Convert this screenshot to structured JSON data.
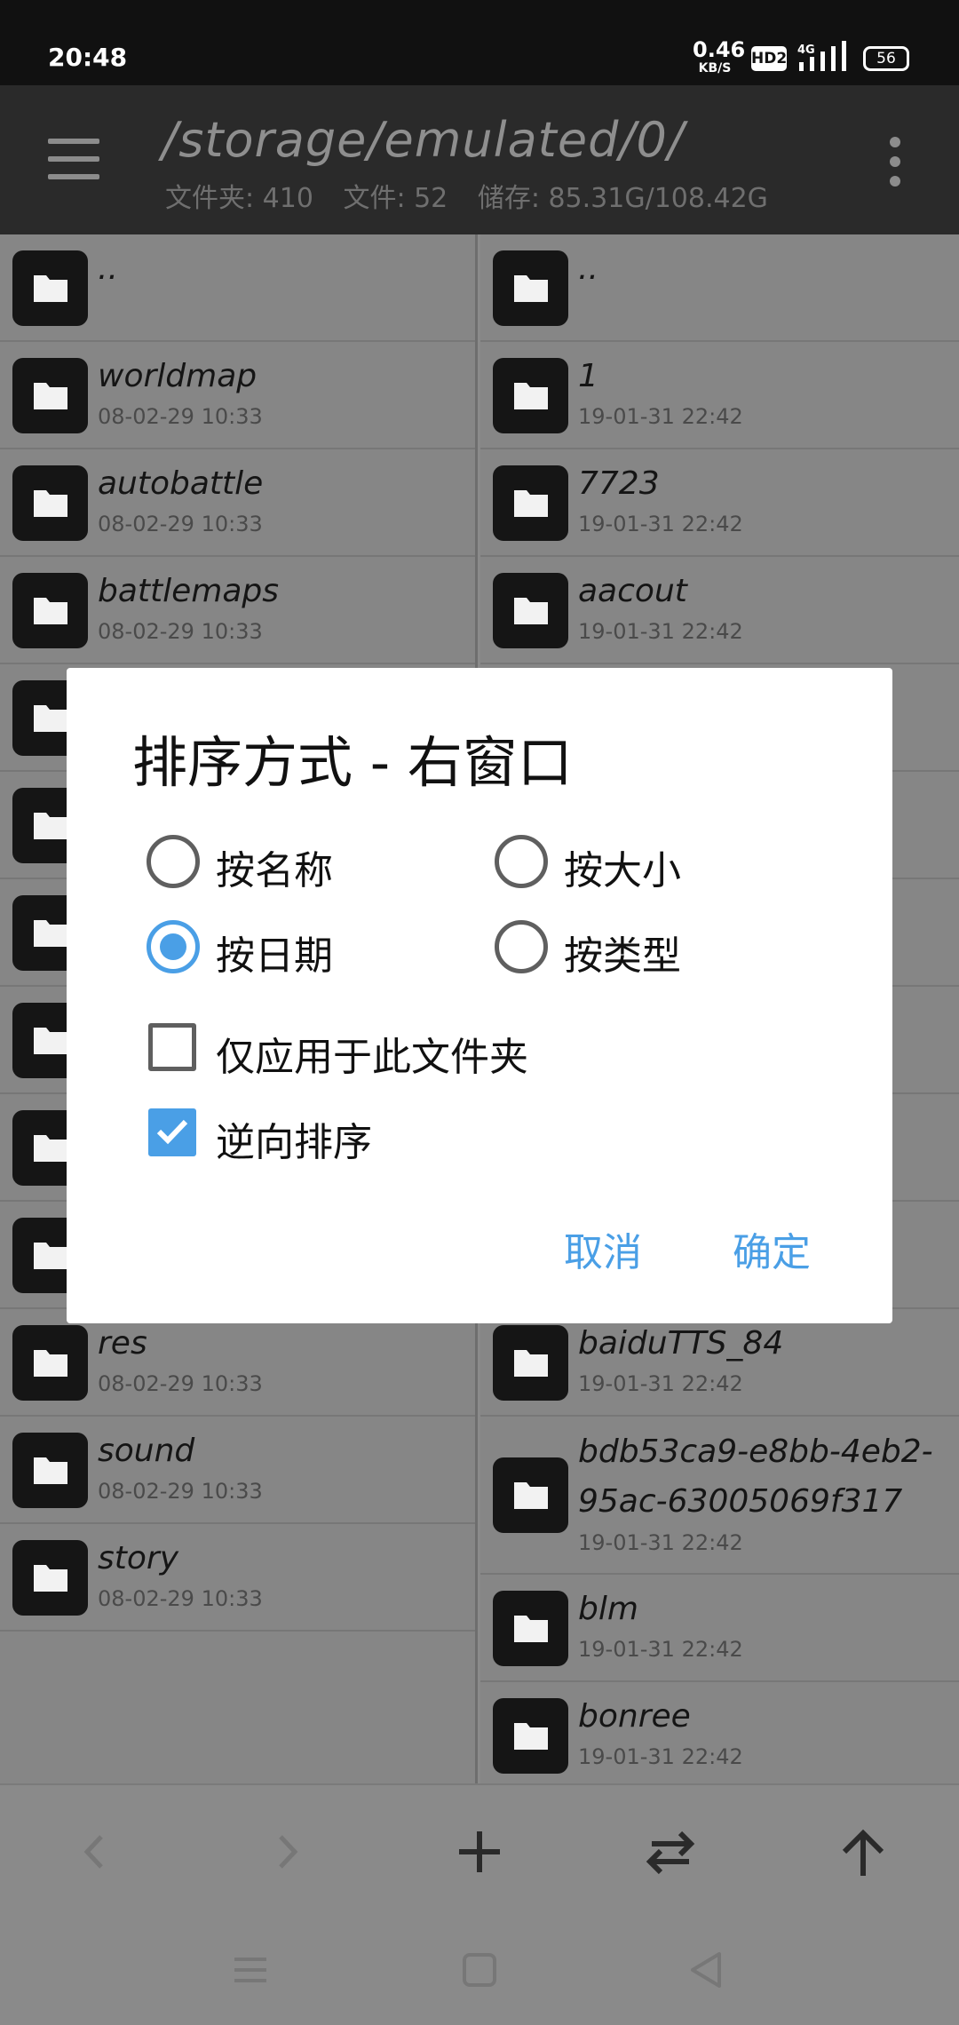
{
  "status": {
    "time": "20:48",
    "speed_value": "0.46",
    "speed_unit": "KB/S",
    "hd": "HD2",
    "network": "4G",
    "battery": "56"
  },
  "toolbar": {
    "path": "/storage/emulated/0/",
    "folders": "文件夹: 410",
    "files": "文件: 52",
    "storage": "储存: 85.31G/108.42G"
  },
  "left_pane": {
    "rows": [
      {
        "name": "..",
        "date": ""
      },
      {
        "name": "worldmap",
        "date": "08-02-29 10:33"
      },
      {
        "name": "autobattle",
        "date": "08-02-29 10:33"
      },
      {
        "name": "battlemaps",
        "date": "08-02-29 10:33"
      },
      {
        "name": "",
        "date": ""
      },
      {
        "name": "",
        "date": ""
      },
      {
        "name": "",
        "date": ""
      },
      {
        "name": "",
        "date": ""
      },
      {
        "name": "",
        "date": ""
      },
      {
        "name": "",
        "date": ""
      },
      {
        "name": "res",
        "date": "08-02-29 10:33"
      },
      {
        "name": "sound",
        "date": "08-02-29 10:33"
      },
      {
        "name": "story",
        "date": "08-02-29 10:33"
      }
    ]
  },
  "right_pane": {
    "rows": [
      {
        "name": "..",
        "date": ""
      },
      {
        "name": "1",
        "date": "19-01-31 22:42"
      },
      {
        "name": "7723",
        "date": "19-01-31 22:42"
      },
      {
        "name": "aacout",
        "date": "19-01-31 22:42"
      },
      {
        "name": "",
        "date": ""
      },
      {
        "name": "",
        "date": ""
      },
      {
        "name": "",
        "date": ""
      },
      {
        "name": "",
        "date": ""
      },
      {
        "name": "",
        "date": ""
      },
      {
        "name": "",
        "date": ""
      },
      {
        "name": "baiduTTS_84",
        "date": "19-01-31 22:42"
      },
      {
        "name": "bdb53ca9-e8bb-4eb2-95ac-63005069f317",
        "date": "19-01-31 22:42"
      },
      {
        "name": "blm",
        "date": "19-01-31 22:42"
      },
      {
        "name": "bonree",
        "date": "19-01-31 22:42"
      }
    ]
  },
  "dialog": {
    "title": "排序方式 - 右窗口",
    "sort_by_name": "按名称",
    "sort_by_size": "按大小",
    "sort_by_date": "按日期",
    "sort_by_type": "按类型",
    "selected": "sort_by_date",
    "apply_folder_only": "仅应用于此文件夹",
    "apply_folder_only_checked": false,
    "reverse_sort": "逆向排序",
    "reverse_sort_checked": true,
    "cancel": "取消",
    "ok": "确定"
  },
  "colors": {
    "accent": "#4a9fe6",
    "toolbar_bg": "#2a2a2a",
    "overlay": "#8a8a8a"
  }
}
